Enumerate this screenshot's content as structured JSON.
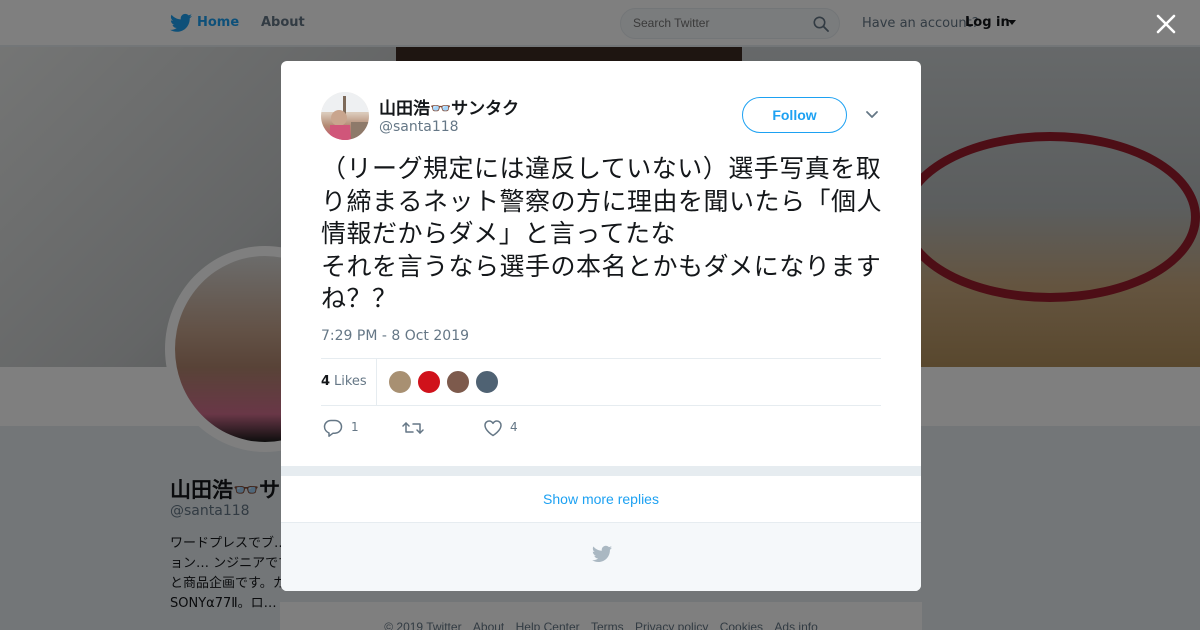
{
  "nav": {
    "home_label": "Home",
    "about_label": "About",
    "search_placeholder": "Search Twitter",
    "account_prompt": "Have an account?",
    "login_label": "Log in"
  },
  "profile": {
    "name": "山田浩👓サンタク",
    "handle": "@santa118",
    "bio": "ワードプレスでブ… ス　ファッション… ンジニアです専門… 財産と商品企画です。カメラは SONYα77Ⅱ。ロ…"
  },
  "tweet": {
    "author_name": "山田浩👓サンタク",
    "author_handle": "@santa118",
    "follow_label": "Follow",
    "text": "（リーグ規定には違反していない）選手写真を取り締まるネット警察の方に理由を聞いたら「個人情報だからダメ」と言ってたな\nそれを言うなら選手の本名とかもダメになりますね？？",
    "timestamp": "7:29 PM - 8 Oct 2019",
    "likes_count": "4",
    "likes_label": "Likes",
    "reply_count": "1",
    "retweet_count": "",
    "like_count": "4"
  },
  "likers": [
    {
      "name": "liker-1",
      "color": "#a89072"
    },
    {
      "name": "liker-2",
      "color": "#d0121b"
    },
    {
      "name": "liker-3",
      "color": "#7d5a4c"
    },
    {
      "name": "liker-4",
      "color": "#4f6273"
    }
  ],
  "modal": {
    "show_more_label": "Show more replies"
  },
  "footer": {
    "copyright": "© 2019 Twitter",
    "about": "About",
    "help": "Help Center",
    "terms": "Terms",
    "privacy": "Privacy policy",
    "cookies": "Cookies",
    "ads": "Ads info"
  },
  "colors": {
    "accent": "#1da1f2",
    "text_primary": "#14171a",
    "text_secondary": "#657786",
    "overlay": "rgba(0,0,0,0.5)"
  },
  "icons": [
    "twitter-bird-icon",
    "search-icon",
    "close-icon",
    "chevron-down-icon",
    "reply-icon",
    "retweet-icon",
    "heart-icon"
  ]
}
